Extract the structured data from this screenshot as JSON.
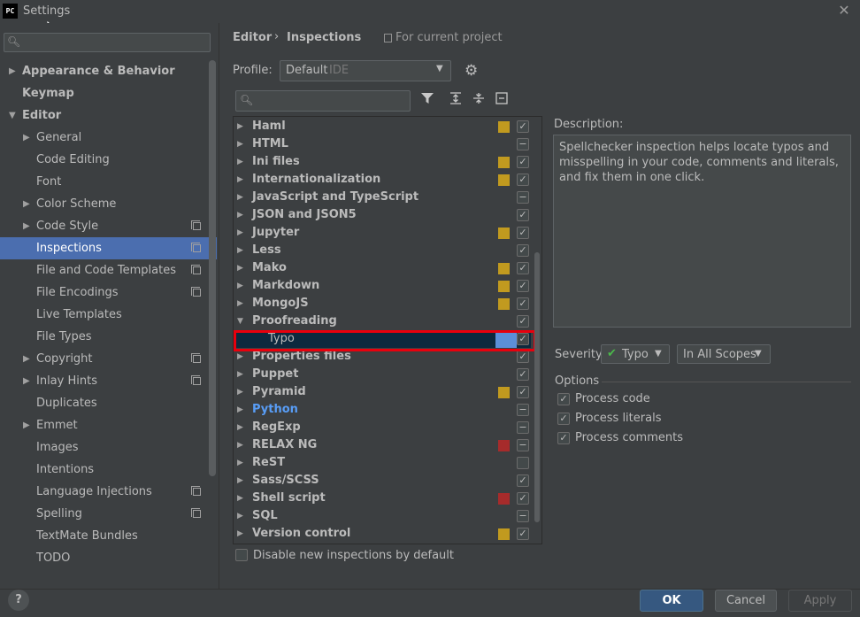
{
  "window": {
    "title": "Settings",
    "app_badge": "PC"
  },
  "sidebar": {
    "search_placeholder": "",
    "items": [
      {
        "label": "Appearance & Behavior",
        "bold": true,
        "arrow": "▶",
        "indent": 0
      },
      {
        "label": "Keymap",
        "bold": true,
        "arrow": "",
        "indent": 0
      },
      {
        "label": "Editor",
        "bold": true,
        "arrow": "▼",
        "indent": 0
      },
      {
        "label": "General",
        "arrow": "▶",
        "indent": 1
      },
      {
        "label": "Code Editing",
        "arrow": "",
        "indent": 1
      },
      {
        "label": "Font",
        "arrow": "",
        "indent": 1
      },
      {
        "label": "Color Scheme",
        "arrow": "▶",
        "indent": 1
      },
      {
        "label": "Code Style",
        "arrow": "▶",
        "indent": 1,
        "copy": true
      },
      {
        "label": "Inspections",
        "arrow": "",
        "indent": 1,
        "copy": true,
        "selected": true
      },
      {
        "label": "File and Code Templates",
        "arrow": "",
        "indent": 1,
        "copy": true
      },
      {
        "label": "File Encodings",
        "arrow": "",
        "indent": 1,
        "copy": true
      },
      {
        "label": "Live Templates",
        "arrow": "",
        "indent": 1
      },
      {
        "label": "File Types",
        "arrow": "",
        "indent": 1
      },
      {
        "label": "Copyright",
        "arrow": "▶",
        "indent": 1,
        "copy": true
      },
      {
        "label": "Inlay Hints",
        "arrow": "▶",
        "indent": 1,
        "copy": true
      },
      {
        "label": "Duplicates",
        "arrow": "",
        "indent": 1
      },
      {
        "label": "Emmet",
        "arrow": "▶",
        "indent": 1
      },
      {
        "label": "Images",
        "arrow": "",
        "indent": 1
      },
      {
        "label": "Intentions",
        "arrow": "",
        "indent": 1
      },
      {
        "label": "Language Injections",
        "arrow": "",
        "indent": 1,
        "copy": true
      },
      {
        "label": "Spelling",
        "arrow": "",
        "indent": 1,
        "copy": true
      },
      {
        "label": "TextMate Bundles",
        "arrow": "",
        "indent": 1
      },
      {
        "label": "TODO",
        "arrow": "",
        "indent": 1
      }
    ]
  },
  "header": {
    "breadcrumb_parent": "Editor",
    "breadcrumb_sep": "›",
    "breadcrumb_current": "Inspections",
    "project_scope": "For current project"
  },
  "profile": {
    "label": "Profile:",
    "value": "Default",
    "sub": "IDE"
  },
  "inspections": [
    {
      "label": "Haml",
      "arrow": "▶",
      "sev": "#c19a1f",
      "check": "✓"
    },
    {
      "label": "HTML",
      "arrow": "▶",
      "sev": "",
      "check": "−"
    },
    {
      "label": "Ini files",
      "arrow": "▶",
      "sev": "#c19a1f",
      "check": "✓"
    },
    {
      "label": "Internationalization",
      "arrow": "▶",
      "sev": "#c19a1f",
      "check": "✓"
    },
    {
      "label": "JavaScript and TypeScript",
      "arrow": "▶",
      "sev": "",
      "check": "−"
    },
    {
      "label": "JSON and JSON5",
      "arrow": "▶",
      "sev": "",
      "check": "✓"
    },
    {
      "label": "Jupyter",
      "arrow": "▶",
      "sev": "#c19a1f",
      "check": "✓"
    },
    {
      "label": "Less",
      "arrow": "▶",
      "sev": "",
      "check": "✓"
    },
    {
      "label": "Mako",
      "arrow": "▶",
      "sev": "#c19a1f",
      "check": "✓"
    },
    {
      "label": "Markdown",
      "arrow": "▶",
      "sev": "#c19a1f",
      "check": "✓"
    },
    {
      "label": "MongoJS",
      "arrow": "▶",
      "sev": "#c19a1f",
      "check": "✓"
    },
    {
      "label": "Proofreading",
      "arrow": "▼",
      "sev": "",
      "check": "✓"
    },
    {
      "label": "Typo",
      "arrow": "",
      "sev": "#5c8fd8",
      "check": "✓",
      "child": true,
      "selected": true
    },
    {
      "label": "Properties files",
      "arrow": "▶",
      "sev": "",
      "check": "✓"
    },
    {
      "label": "Puppet",
      "arrow": "▶",
      "sev": "",
      "check": "✓"
    },
    {
      "label": "Pyramid",
      "arrow": "▶",
      "sev": "#c19a1f",
      "check": "✓"
    },
    {
      "label": "Python",
      "arrow": "▶",
      "sev": "",
      "check": "−",
      "link": true
    },
    {
      "label": "RegExp",
      "arrow": "▶",
      "sev": "",
      "check": "−"
    },
    {
      "label": "RELAX NG",
      "arrow": "▶",
      "sev": "#a62b2b",
      "check": "−"
    },
    {
      "label": "ReST",
      "arrow": "▶",
      "sev": "",
      "check": ""
    },
    {
      "label": "Sass/SCSS",
      "arrow": "▶",
      "sev": "",
      "check": "✓"
    },
    {
      "label": "Shell script",
      "arrow": "▶",
      "sev": "#a62b2b",
      "check": "✓"
    },
    {
      "label": "SQL",
      "arrow": "▶",
      "sev": "",
      "check": "−"
    },
    {
      "label": "Version control",
      "arrow": "▶",
      "sev": "#c19a1f",
      "check": "✓"
    }
  ],
  "disable_new_label": "Disable new inspections by default",
  "description": {
    "label": "Description:",
    "text": "Spellchecker inspection helps locate typos and misspelling in your code, comments and literals, and fix them in one click."
  },
  "severity": {
    "label": "Severity:",
    "value": "Typo",
    "scope": "In All Scopes"
  },
  "options": {
    "label": "Options",
    "items": [
      "Process code",
      "Process literals",
      "Process comments"
    ]
  },
  "footer": {
    "help": "?",
    "ok": "OK",
    "cancel": "Cancel",
    "apply": "Apply"
  }
}
